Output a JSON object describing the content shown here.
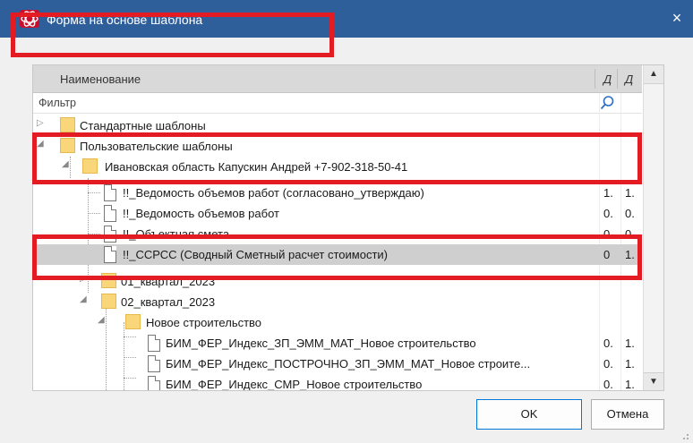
{
  "window": {
    "title": "Форма на основе шаблона",
    "close_glyph": "×",
    "app_icon": "app-logo-icon",
    "accent_color": "#2f5f9a",
    "highlight_color": "#e31b23"
  },
  "grid": {
    "columns": [
      "Наименование",
      "Д",
      "Д"
    ],
    "filter_label": "Фильтр",
    "rows": [
      {
        "type": "folder",
        "toggle": "▷",
        "label": "Стандартные шаблоны",
        "v1": "",
        "v2": ""
      },
      {
        "type": "folder",
        "toggle": "◢",
        "label": "Пользовательские шаблоны",
        "v1": "",
        "v2": ""
      },
      {
        "type": "folder",
        "toggle": "◢",
        "label": "Ивановская область Капускин Андрей +7-902-318-50-41",
        "v1": "",
        "v2": ""
      },
      {
        "type": "file",
        "toggle": "",
        "label": "!!_Ведомость объемов работ (согласовано_утверждаю)",
        "v1": "1.",
        "v2": "1."
      },
      {
        "type": "file",
        "toggle": "",
        "label": "!!_Ведомость объемов работ",
        "v1": "0.",
        "v2": "0."
      },
      {
        "type": "file",
        "toggle": "",
        "label": "!!_Объектная смета",
        "v1": "0.",
        "v2": "0."
      },
      {
        "type": "file",
        "toggle": "",
        "label": "!!_ССРСС (Сводный Сметный расчет стоимости)",
        "v1": "0",
        "v2": "1.",
        "selected": true
      },
      {
        "type": "folder",
        "toggle": "▷",
        "label": "01_квартал_2023",
        "v1": "",
        "v2": ""
      },
      {
        "type": "folder",
        "toggle": "◢",
        "label": "02_квартал_2023",
        "v1": "",
        "v2": ""
      },
      {
        "type": "folder",
        "toggle": "◢",
        "label": "Новое строительство",
        "v1": "",
        "v2": ""
      },
      {
        "type": "file",
        "toggle": "",
        "label": "БИМ_ФЕР_Индекс_ЗП_ЭММ_МАТ_Новое строительство",
        "v1": "0.",
        "v2": "1."
      },
      {
        "type": "file",
        "toggle": "",
        "label": "БИМ_ФЕР_Индекс_ПОСТРОЧНО_ЗП_ЭММ_МАТ_Новое строите...",
        "v1": "0.",
        "v2": "1."
      },
      {
        "type": "file",
        "toggle": "",
        "label": "БИМ_ФЕР_Индекс_СМР_Новое строительство",
        "v1": "0.",
        "v2": "1."
      }
    ]
  },
  "buttons": {
    "ok": "OK",
    "cancel": "Отмена"
  }
}
